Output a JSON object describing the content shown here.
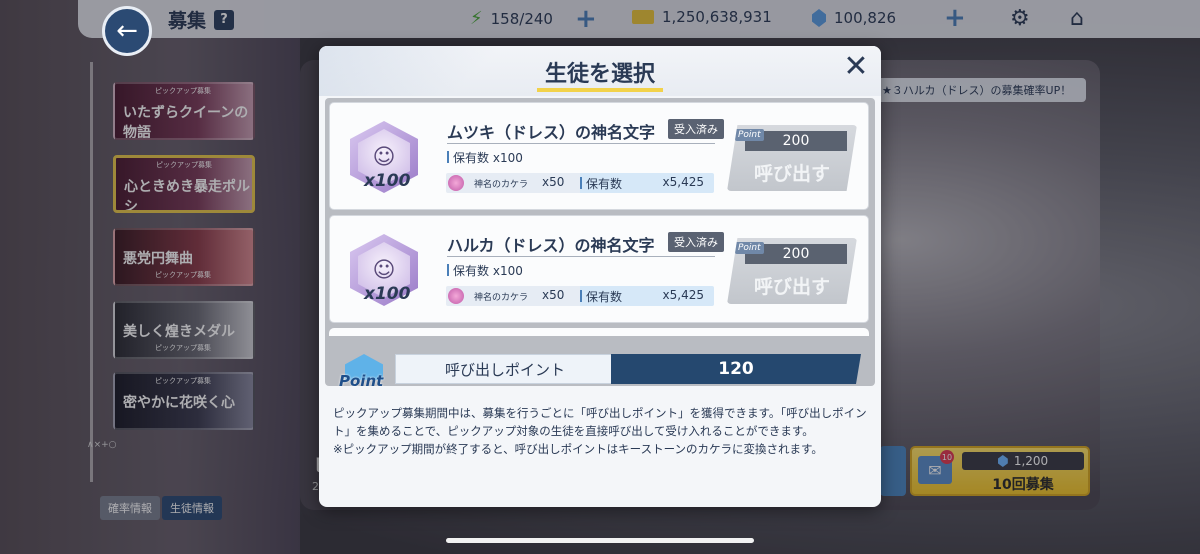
{
  "header": {
    "title": "募集",
    "help": "?",
    "ap": "158/240",
    "credits": "1,250,638,931",
    "gems": "100,826"
  },
  "sidebar": {
    "banners": [
      {
        "text": "いたずらクイーンの物語",
        "tag": "ピックアップ募集"
      },
      {
        "text": "心ときめき暴走ポルシ",
        "tag": "ピックアップ募集"
      },
      {
        "text": "悪党円舞曲",
        "tag": "ピックアップ募集"
      },
      {
        "text": "美しく煌きメダル",
        "tag": "ピックアップ募集"
      },
      {
        "text": "密やかに花咲く心",
        "tag": "ピックアップ募集"
      }
    ],
    "vertical_text": "∧×+○",
    "rates_button": "確率情報",
    "students_button": "生徒情報"
  },
  "background": {
    "pickup_note": "★３ハルカ（ドレス）の募集確率UP！",
    "left_peek": "ヒ",
    "left_peek2": "2",
    "gacha10": {
      "badge": "10",
      "cost": "1,200",
      "label": "10回募集"
    }
  },
  "modal": {
    "title": "生徒を選択",
    "cards": [
      {
        "name": "ムツキ（ドレス）の神名文字",
        "status": "受入済み",
        "qty": "x100",
        "owned_label": "保有数",
        "owned": "x100",
        "karera_label": "神名のカケラ",
        "karera_qty": "x50",
        "karera_owned_label": "保有数",
        "karera_owned": "x5,425",
        "cost": "200",
        "point_tag": "Point",
        "button": "呼び出す"
      },
      {
        "name": "ハルカ（ドレス）の神名文字",
        "status": "受入済み",
        "qty": "x100",
        "owned_label": "保有数",
        "owned": "x100",
        "karera_label": "神名のカケラ",
        "karera_qty": "x50",
        "karera_owned_label": "保有数",
        "karera_owned": "x5,425",
        "cost": "200",
        "point_tag": "Point",
        "button": "呼び出す"
      }
    ],
    "point_icon_text": "Point",
    "point_label": "呼び出しポイント",
    "point_value": "120",
    "description_1": "ピックアップ募集期間中は、募集を行うごとに「呼び出しポイント」を獲得できます。「呼び出しポイント」を集めることで、ピックアップ対象の生徒を直接呼び出して受け入れることができます。",
    "description_2": "※ピックアップ期間が終了すると、呼び出しポイントはキーストーンのカケラに変換されます。"
  },
  "colors": {
    "navy": "#2a3a55",
    "accent_blue": "#25486f",
    "title_underline": "#f2d24a"
  },
  "icons": [
    "back-arrow-icon",
    "ap-bolt-icon",
    "credit-card-icon",
    "gem-icon",
    "gear-icon",
    "home-icon",
    "close-icon",
    "karera-icon",
    "point-envelope-icon",
    "mail-icon"
  ]
}
